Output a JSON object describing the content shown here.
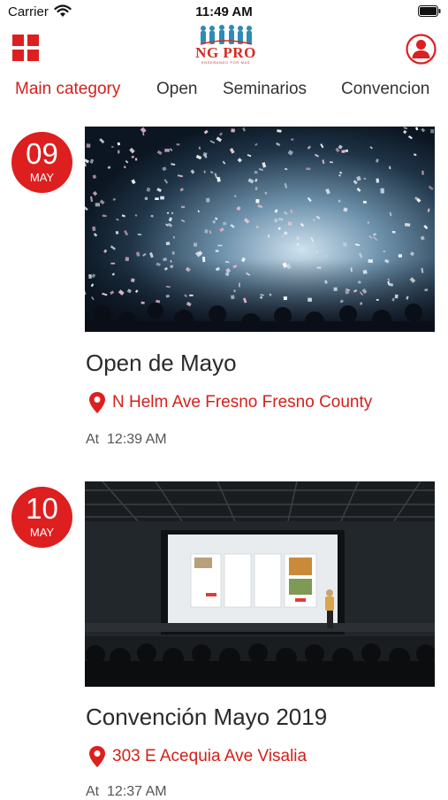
{
  "status_bar": {
    "carrier": "Carrier",
    "time": "11:49 AM"
  },
  "header": {
    "menu_icon": "grid-menu-icon",
    "logo_text": "NG PRO",
    "logo_tagline": "ENSEÑANDO POR MAS",
    "profile_icon": "user-profile-icon",
    "accent_color": "#d3201a"
  },
  "tabs": [
    {
      "label": "Main category",
      "active": true
    },
    {
      "label": "Open",
      "active": false
    },
    {
      "label": "Seminarios",
      "active": false
    },
    {
      "label": "Convencion",
      "active": false
    }
  ],
  "events": [
    {
      "day": "09",
      "month": "MAY",
      "title": "Open de Mayo",
      "location": "N Helm Ave Fresno Fresno County",
      "time_prefix": "At",
      "time": "12:39 AM",
      "image": "confetti-concert-crowd"
    },
    {
      "day": "10",
      "month": "MAY",
      "title": "Convención Mayo 2019",
      "location": "303 E Acequia Ave Visalia",
      "time_prefix": "At",
      "time": "12:37 AM",
      "image": "presentation-stage-audience"
    }
  ]
}
